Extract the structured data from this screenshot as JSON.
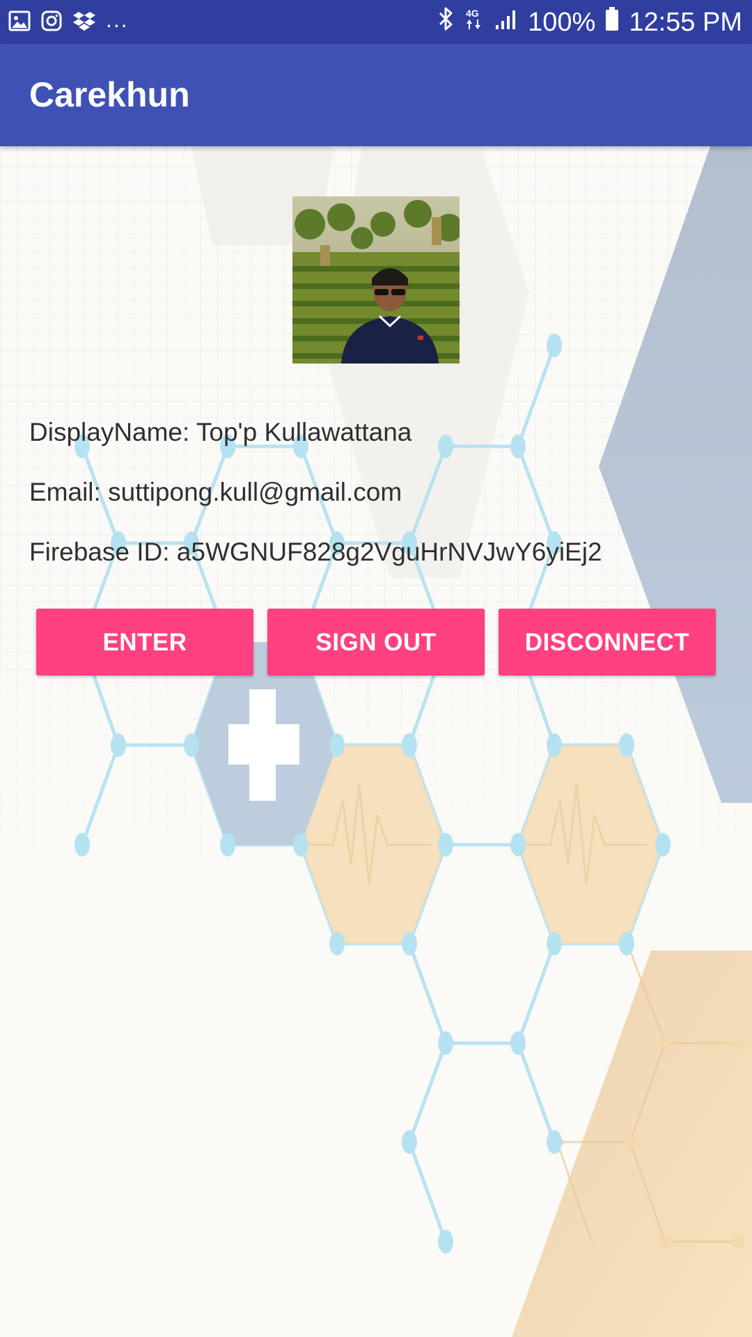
{
  "status_bar": {
    "left_icons": [
      "gallery-icon",
      "instagram-icon",
      "dropbox-icon"
    ],
    "more_indicator": "...",
    "right_icons": [
      "bluetooth-icon",
      "network-4g-icon",
      "signal-icon"
    ],
    "battery_percent": "100%",
    "time": "12:55 PM"
  },
  "app_bar": {
    "title": "Carekhun",
    "color": "#3f51b5"
  },
  "profile": {
    "avatar_icon": "profile-photo",
    "display_name": "DisplayName: Top'p Kullawattana",
    "email": "Email: suttipong.kull@gmail.com",
    "firebase_id": "Firebase ID: a5WGNUF828g2VguHrNVJwY6yiEj2"
  },
  "actions": {
    "enter": "ENTER",
    "sign_out": "SIGN OUT",
    "disconnect": "DISCONNECT",
    "accent_color": "#ff4081"
  }
}
